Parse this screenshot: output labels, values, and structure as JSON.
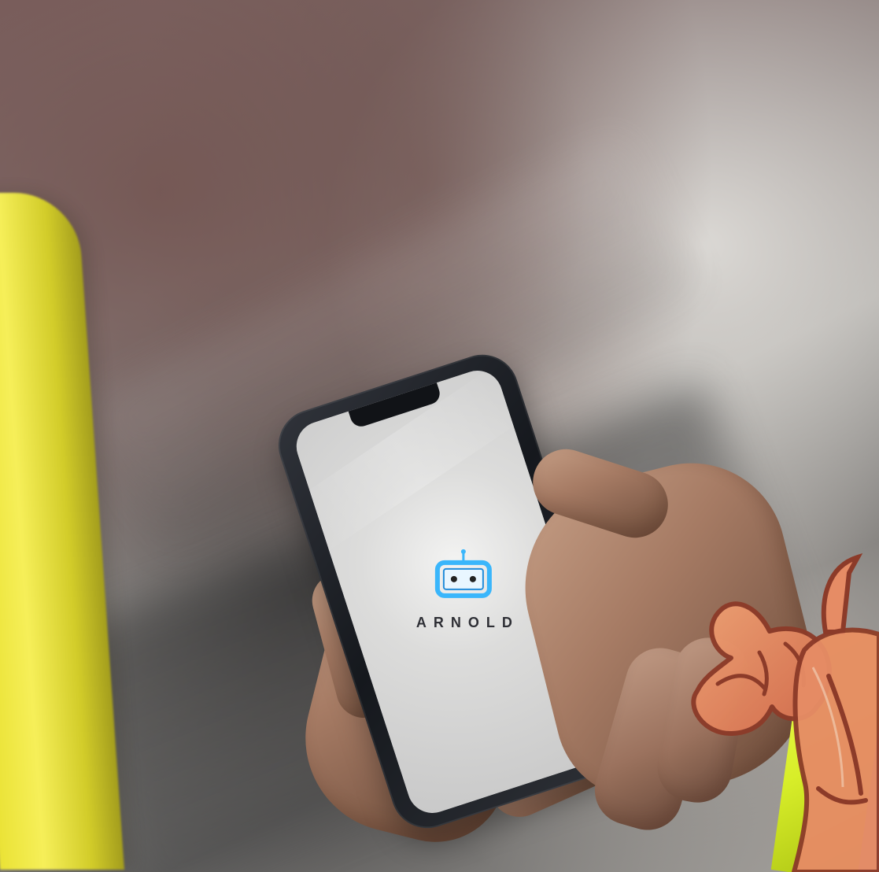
{
  "brand": {
    "name": "ARNOLD",
    "logo_icon": "robot-head-icon"
  },
  "colors": {
    "yellow_pole": "#f1e83b",
    "phone_frame": "#1b1e23",
    "screen": "#dddddd",
    "logo_blue": "#36b7ff",
    "logo_text": "#2e2f35",
    "mascot_skin": "#e98b63",
    "mascot_outline": "#8f3a28",
    "neon_yellow": "#e7ff37"
  },
  "elements": {
    "background": "blurred-urban-background",
    "phone": "smartphone",
    "hands": "two-hands-holding-phone",
    "mascot": "flexing-muscle-mascot"
  }
}
